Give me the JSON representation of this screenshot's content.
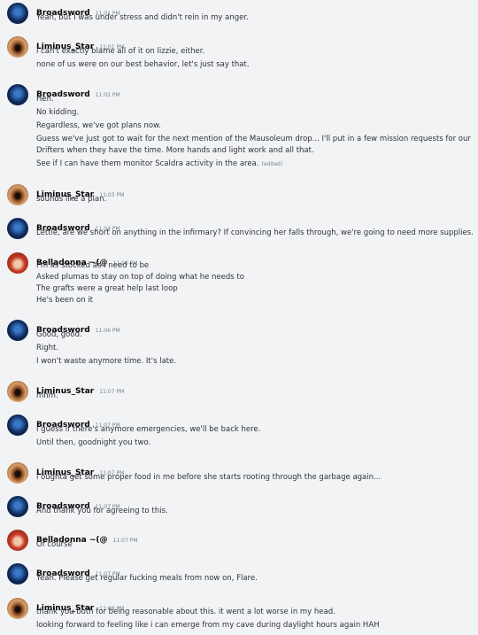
{
  "colors": {
    "background": "#f2f3f5",
    "username": "#060607",
    "timestamp": "#747f8d",
    "text": "#2e3338"
  },
  "messages": [
    {
      "author": "Broadsword",
      "avatar": "broadsword",
      "time": "11:01 PM",
      "lines": [
        "Yeah, but I was under stress and didn't rein in my anger."
      ]
    },
    {
      "author": "Liminus_Star",
      "avatar": "liminus",
      "time": "11:01 PM",
      "lines": [
        "i can't exactly blame all of it on lizzie, either.",
        "none of us were on our best behavior, let's just say that."
      ]
    },
    {
      "author": "Broadsword",
      "avatar": "broadsword",
      "time": "11:02 PM",
      "lines": [
        "Heh.",
        "No kidding.",
        "Regardless, we've got plans now.",
        "Guess we've just got to wait for the next mention of the Mausoleum drop... I'll put in a few mission requests for our",
        "Drifters when they have the time. More hands and light work and all that.",
        "See if I can have them monitor Scaldra activity in the area."
      ],
      "edited_label": "(edited)"
    },
    {
      "author": "Liminus_Star",
      "avatar": "liminus",
      "time": "11:03 PM",
      "lines": [
        "sounds like a plan."
      ]
    },
    {
      "author": "Broadsword",
      "avatar": "broadsword",
      "time": "11:04 PM",
      "lines": [
        "Lettie, are we short on anything in the infirmary? If convincing her falls through, we're going to need more supplies."
      ]
    },
    {
      "author": "Belladonna ~(@",
      "avatar": "belladonna",
      "time": "11:06 PM",
      "lines": [
        "I'm as stocked as I need to be",
        "Asked plumas to stay on top of doing what he needs to",
        "The grafts were a great help last loop",
        "He's been on it"
      ]
    },
    {
      "author": "Broadsword",
      "avatar": "broadsword",
      "time": "11:06 PM",
      "lines": [
        "Good, good.",
        "Right.",
        "I won't waste anymore time. It's late."
      ]
    },
    {
      "author": "Liminus_Star",
      "avatar": "liminus",
      "time": "11:07 PM",
      "lines": [
        "mhm."
      ]
    },
    {
      "author": "Broadsword",
      "avatar": "broadsword",
      "time": "11:07 PM",
      "lines": [
        "I guess if there's anymore emergencies, we'll be back here.",
        "Until then, goodnight you two."
      ]
    },
    {
      "author": "Liminus_Star",
      "avatar": "liminus",
      "time": "11:07 PM",
      "lines": [
        "i oughta get some proper food in me before she starts rooting through the garbage again..."
      ]
    },
    {
      "author": "Broadsword",
      "avatar": "broadsword",
      "time": "11:07 PM",
      "lines": [
        "And thank you for agreeing to this."
      ]
    },
    {
      "author": "Belladonna ~(@",
      "avatar": "belladonna",
      "time": "11:07 PM",
      "lines": [
        "Of course"
      ]
    },
    {
      "author": "Broadsword",
      "avatar": "broadsword",
      "time": "11:07 PM",
      "lines": [
        "Yeah. Please get regular fucking meals from now on, Flare."
      ]
    },
    {
      "author": "Liminus_Star",
      "avatar": "liminus",
      "time": "11:08 PM",
      "lines": [
        "thank you both for being reasonable about this. it went a lot worse in my head.",
        "looking forward to feeling like i can emerge from my cave during daylight hours again HAH"
      ]
    }
  ]
}
